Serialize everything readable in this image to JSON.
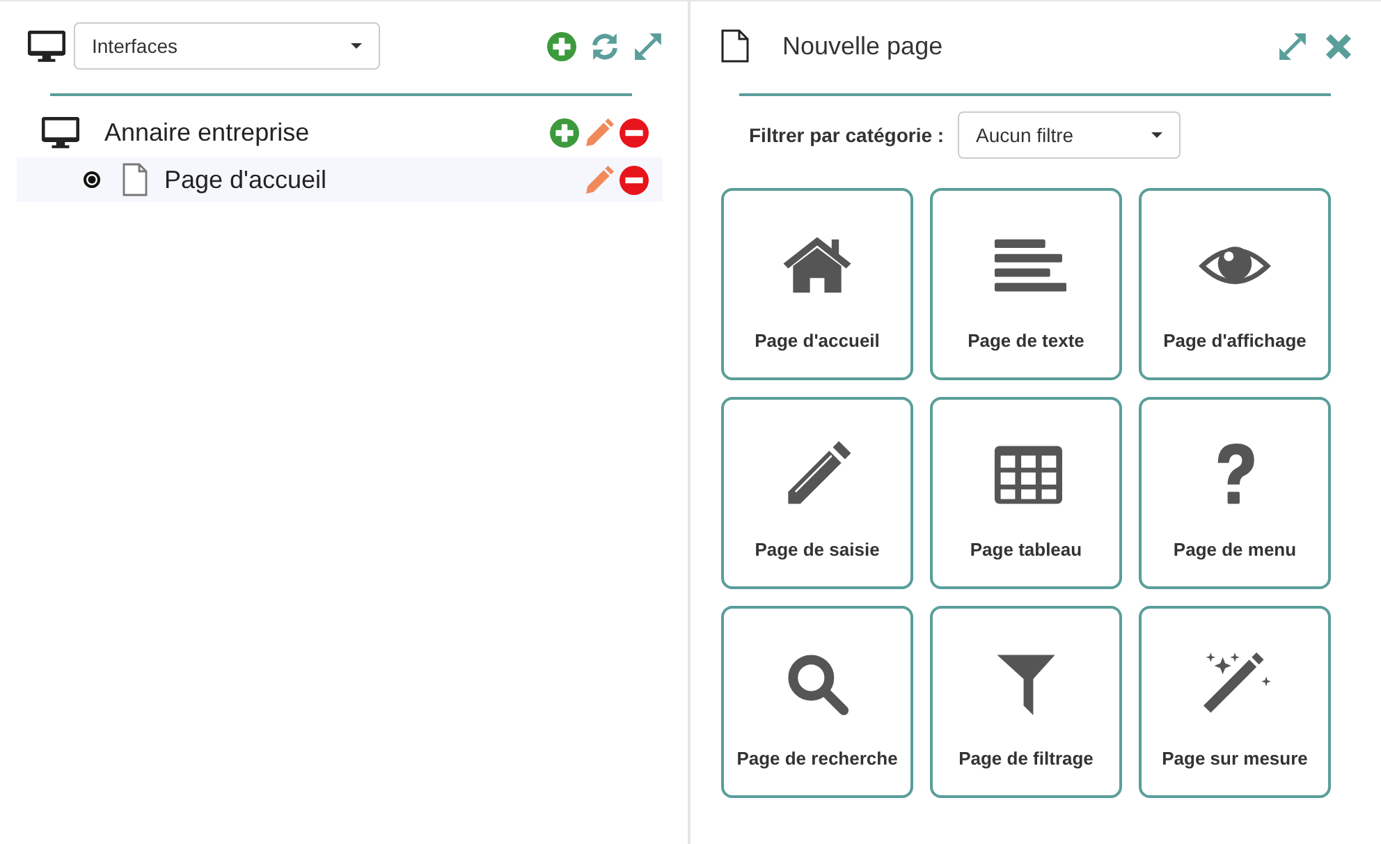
{
  "left_panel": {
    "selector": {
      "value": "Interfaces"
    },
    "tree": [
      {
        "label": "Annaire entreprise",
        "kind": "interface",
        "can_add": true,
        "can_edit": true,
        "can_remove": true,
        "children": [
          {
            "label": "Page d'accueil",
            "kind": "page",
            "can_add": false,
            "can_edit": true,
            "can_remove": true,
            "selected": true
          }
        ]
      }
    ]
  },
  "right_panel": {
    "title": "Nouvelle page",
    "filter": {
      "label": "Filtrer par catégorie :",
      "value": "Aucun filtre"
    },
    "tiles": [
      {
        "label": "Page d'accueil",
        "kind": "home"
      },
      {
        "label": "Page de texte",
        "kind": "text"
      },
      {
        "label": "Page d'affichage",
        "kind": "eye"
      },
      {
        "label": "Page de saisie",
        "kind": "pencil"
      },
      {
        "label": "Page tableau",
        "kind": "table"
      },
      {
        "label": "Page de menu",
        "kind": "question"
      },
      {
        "label": "Page de recherche",
        "kind": "search"
      },
      {
        "label": "Page de filtrage",
        "kind": "filter"
      },
      {
        "label": "Page sur mesure",
        "kind": "wand"
      }
    ]
  }
}
